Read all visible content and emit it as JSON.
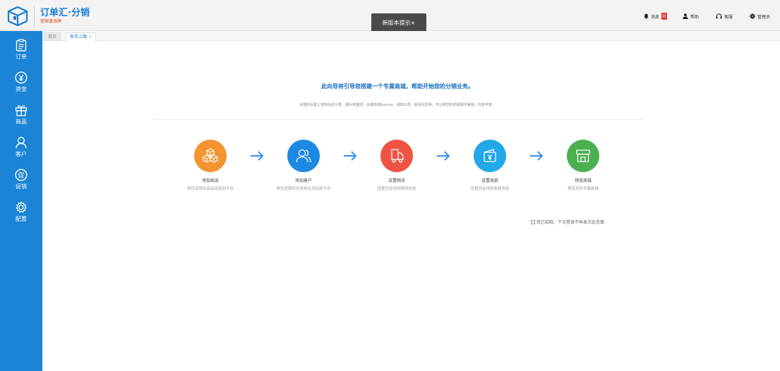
{
  "app": {
    "title": "订单汇·分销",
    "subtitle": "管家婆品牌"
  },
  "header": {
    "version_tip": "新版本提示×",
    "messages_label": "消息",
    "messages_count": "0",
    "help_label": "帮助",
    "service_label": "客服",
    "admin_label": "管理员"
  },
  "sidebar": {
    "items": [
      {
        "label": "订单",
        "icon": "order-icon"
      },
      {
        "label": "资金",
        "icon": "yuan-icon"
      },
      {
        "label": "商品",
        "icon": "gift-icon"
      },
      {
        "label": "客户",
        "icon": "customer-icon"
      },
      {
        "label": "促销",
        "icon": "promo-icon"
      },
      {
        "label": "配置",
        "icon": "settings-icon"
      }
    ]
  },
  "tabs": {
    "home": "首页",
    "active": "新手上路",
    "close": "X"
  },
  "main": {
    "title": "此向导将引导您搭建一个专属商城，帮助开始您的分销业务。",
    "description": "合理的设置上架商品的分类、图片和描述，设置商城banner、通知公告、联系信息等，可以使您的商城展示美观，内容丰富。",
    "steps": [
      {
        "title": "添加商品",
        "desc": "将您进销存商品添加到平台",
        "color": "#f39431",
        "icon": "cubes-icon"
      },
      {
        "title": "添加客户",
        "desc": "将您进销存往来单位添加到平台",
        "color": "#1e88e5",
        "icon": "users-icon"
      },
      {
        "title": "设置物流",
        "desc": "设置您支持的物流信息",
        "color": "#ef5343",
        "icon": "truck-icon"
      },
      {
        "title": "设置收款",
        "desc": "设置您支持的收款信息",
        "color": "#21a8e6",
        "icon": "wallet-icon"
      },
      {
        "title": "预览商城",
        "desc": "预览您的专属商城",
        "color": "#4caf50",
        "icon": "store-icon"
      }
    ],
    "acknowledge": "我已知晓，下次登录不再显示此页面"
  },
  "colors": {
    "sidebar": "#1c84d6",
    "accent": "#1a7fd4",
    "arrow": "#3a8ee6"
  }
}
